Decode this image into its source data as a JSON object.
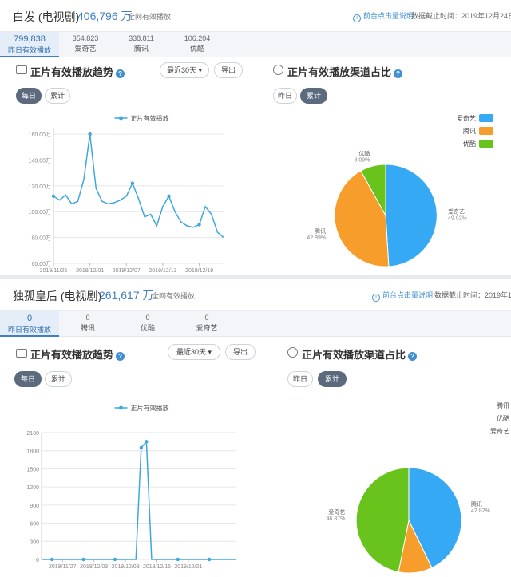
{
  "panel1": {
    "title": "白发 (电视剧)",
    "total": "406,796 万",
    "total_label": "全网有效播放",
    "note": "前台点击量说明",
    "date": "数据截止时间：2019年12月24日",
    "tabs": [
      {
        "value": "799,838",
        "label": "昨日有效播放"
      },
      {
        "value": "354,823",
        "label": "爱奇艺"
      },
      {
        "value": "338,811",
        "label": "腾讯"
      },
      {
        "value": "106,204",
        "label": "优酷"
      }
    ],
    "trend_title": "正片有效播放趋势",
    "range_select": "最近30天",
    "export": "导出",
    "daily": "每日",
    "cumulative": "累计",
    "share_title": "正片有效播放渠道占比",
    "yesterday": "昨日",
    "cumulative2": "累计"
  },
  "panel2": {
    "title": "独孤皇后 (电视剧)",
    "total": "261,617 万",
    "total_label": "全网有效播放",
    "note": "前台点击量说明",
    "date": "数据截止时间：2019年12月",
    "tabs": [
      {
        "value": "0",
        "label": "昨日有效播放"
      },
      {
        "value": "0",
        "label": "腾讯"
      },
      {
        "value": "0",
        "label": "优酷"
      },
      {
        "value": "0",
        "label": "爱奇艺"
      }
    ],
    "trend_title": "正片有效播放趋势",
    "range_select": "最近30天",
    "export": "导出",
    "daily": "每日",
    "cumulative": "累计",
    "share_title": "正片有效播放渠道占比",
    "yesterday": "昨日",
    "cumulative2": "累计"
  },
  "chart_data": [
    {
      "type": "line",
      "series": [
        {
          "name": "正片有效播放",
          "color": "#3fa7dd",
          "values": [
            112,
            109,
            113,
            106,
            108,
            125,
            160,
            118,
            108,
            106,
            107,
            109,
            112,
            122,
            110,
            96,
            98,
            89,
            104,
            112,
            100,
            92,
            89,
            88,
            90,
            104,
            98,
            84,
            80
          ]
        }
      ],
      "x": [
        "2019/11/25",
        "2019/11/26",
        "2019/11/27",
        "2019/11/28",
        "2019/11/29",
        "2019/11/30",
        "2019/12/01",
        "2019/12/02",
        "2019/12/03",
        "2019/12/04",
        "2019/12/05",
        "2019/12/06",
        "2019/12/07",
        "2019/12/08",
        "2019/12/09",
        "2019/12/10",
        "2019/12/11",
        "2019/12/12",
        "2019/12/13",
        "2019/12/14",
        "2019/12/15",
        "2019/12/16",
        "2019/12/17",
        "2019/12/18",
        "2019/12/19",
        "2019/12/20",
        "2019/12/21",
        "2019/12/22",
        "2019/12/23"
      ],
      "xticks": [
        "2019/11/25",
        "2019/12/01",
        "2019/12/07",
        "2019/12/13",
        "2019/12/19"
      ],
      "yticks": [
        "60.00万",
        "80.00万",
        "100.00万",
        "120.00万",
        "140.00万",
        "160.00万"
      ],
      "ylim": [
        60,
        165
      ],
      "grid": true,
      "legend": "top-center"
    },
    {
      "type": "pie",
      "slices": [
        {
          "label": "爱奇艺",
          "pct": "49.02%",
          "value": 49.02,
          "color": "#36a9f4"
        },
        {
          "label": "腾讯",
          "pct": "42.89%",
          "value": 42.89,
          "color": "#f79d2c"
        },
        {
          "label": "优酷",
          "pct": "8.09%",
          "value": 8.09,
          "color": "#68c31c"
        }
      ],
      "legend": "top-right"
    },
    {
      "type": "line",
      "series": [
        {
          "name": "正片有效播放",
          "color": "#3fa7dd",
          "values": [
            0,
            0,
            0,
            0,
            0,
            0,
            0,
            0,
            0,
            0,
            0,
            0,
            0,
            0,
            0,
            0,
            0,
            0,
            0,
            1850,
            1950,
            0,
            0,
            0,
            0,
            0,
            0,
            0,
            0,
            0,
            0,
            0,
            0,
            0,
            0,
            0,
            0,
            0
          ]
        }
      ],
      "x": [
        "2019/11/23",
        "2019/11/24",
        "2019/11/25",
        "2019/11/26",
        "2019/11/27",
        "2019/11/28",
        "2019/11/29",
        "2019/11/30",
        "2019/12/01",
        "2019/12/02",
        "2019/12/03",
        "2019/12/04",
        "2019/12/05",
        "2019/12/06",
        "2019/12/07",
        "2019/12/08",
        "2019/12/09",
        "2019/12/10",
        "2019/12/11",
        "2019/12/12",
        "2019/12/13",
        "2019/12/14",
        "2019/12/15",
        "2019/12/16",
        "2019/12/17",
        "2019/12/18",
        "2019/12/19",
        "2019/12/20",
        "2019/12/21",
        "2019/12/22",
        "2019/12/23",
        "2019/12/24",
        "2019/12/25",
        "2019/12/26",
        "2019/12/27",
        "2019/12/28",
        "2019/12/29",
        "2019/12/30"
      ],
      "xticks": [
        "2019/11/27",
        "2019/12/03",
        "2019/12/09",
        "2019/12/15",
        "2019/12/21"
      ],
      "yticks": [
        "0",
        "300",
        "600",
        "900",
        "1200",
        "1500",
        "1800",
        "2100"
      ],
      "ylim": [
        0,
        2100
      ],
      "grid": true,
      "legend": "top-center"
    },
    {
      "type": "pie",
      "slices": [
        {
          "label": "腾讯",
          "pct": "42.82%",
          "value": 42.82,
          "color": "#36a9f4"
        },
        {
          "label": "优酷",
          "pct": "10.31%",
          "value": 10.31,
          "color": "#f79d2c"
        },
        {
          "label": "爱奇艺",
          "pct": "46.87%",
          "value": 46.87,
          "color": "#68c31c"
        }
      ],
      "legend": "top-right"
    }
  ]
}
